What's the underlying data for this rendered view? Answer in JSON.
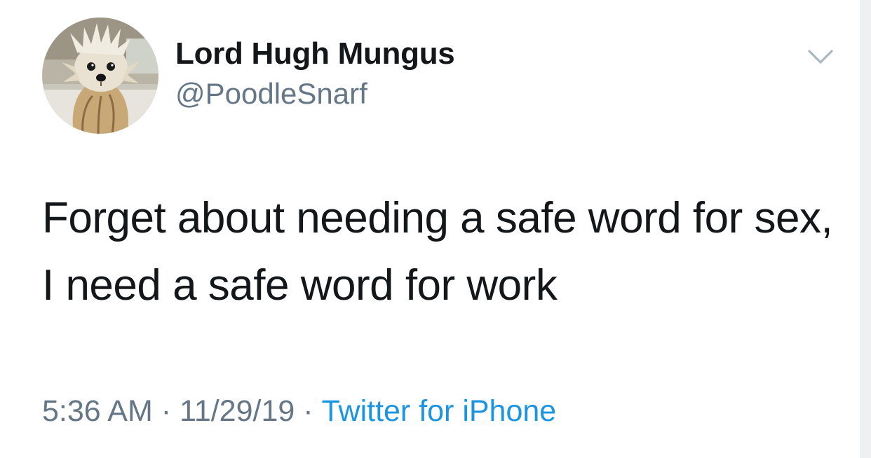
{
  "tweet": {
    "author": {
      "display_name": "Lord Hugh Mungus",
      "handle": "@PoodleSnarf",
      "avatar_icon": "wet-poodle-avatar"
    },
    "text": "Forget about needing a safe word for sex, I need a safe word for work",
    "time": "5:36 AM",
    "separator": "·",
    "date": "11/29/19",
    "source": "Twitter for iPhone"
  },
  "colors": {
    "text": "#14171a",
    "secondary": "#657786",
    "link": "#1b95e0",
    "caret": "#aab8c2"
  },
  "icons": {
    "menu": "chevron-down-icon"
  }
}
